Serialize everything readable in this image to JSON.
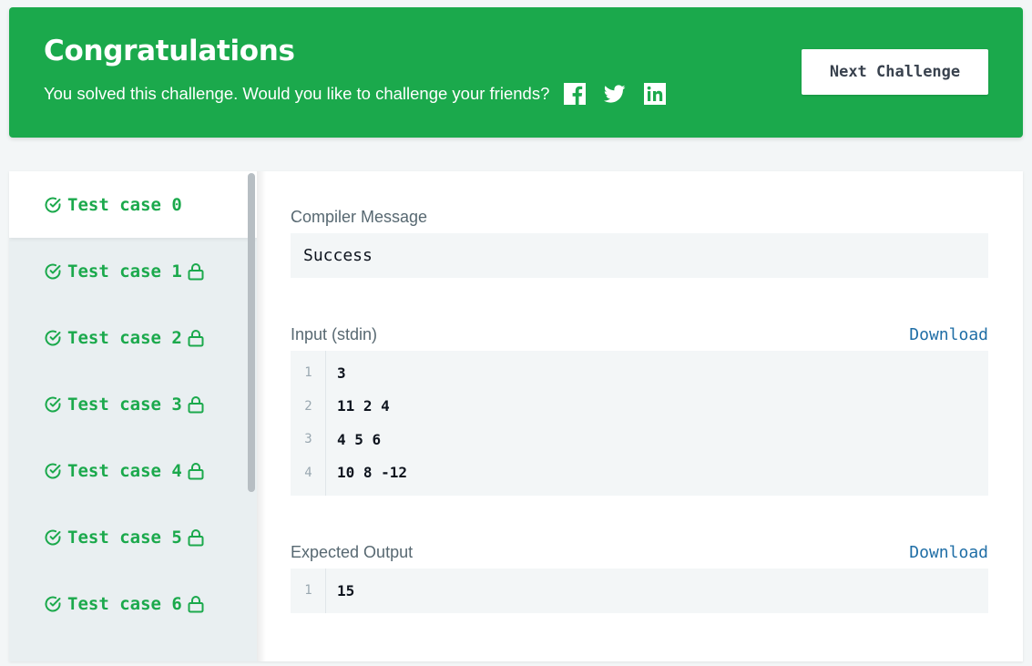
{
  "banner": {
    "title": "Congratulations",
    "subtitle": "You solved this challenge. Would you like to challenge your friends?",
    "social": [
      "facebook-icon",
      "twitter-icon",
      "linkedin-icon"
    ],
    "next_label": "Next Challenge",
    "color": "#1ba94c"
  },
  "tabs": [
    {
      "label": "Test case 0",
      "locked": false,
      "passed": true
    },
    {
      "label": "Test case 1",
      "locked": true,
      "passed": true
    },
    {
      "label": "Test case 2",
      "locked": true,
      "passed": true
    },
    {
      "label": "Test case 3",
      "locked": true,
      "passed": true
    },
    {
      "label": "Test case 4",
      "locked": true,
      "passed": true
    },
    {
      "label": "Test case 5",
      "locked": true,
      "passed": true
    },
    {
      "label": "Test case 6",
      "locked": true,
      "passed": true
    }
  ],
  "compiler": {
    "label": "Compiler Message",
    "message": "Success"
  },
  "input": {
    "label": "Input (stdin)",
    "download": "Download",
    "lines": [
      {
        "n": "1",
        "text": "3"
      },
      {
        "n": "2",
        "text": "11 2 4"
      },
      {
        "n": "3",
        "text": "4 5 6"
      },
      {
        "n": "4",
        "text": "10 8 -12"
      }
    ]
  },
  "output": {
    "label": "Expected Output",
    "download": "Download",
    "lines": [
      {
        "n": "1",
        "text": "15"
      }
    ]
  }
}
